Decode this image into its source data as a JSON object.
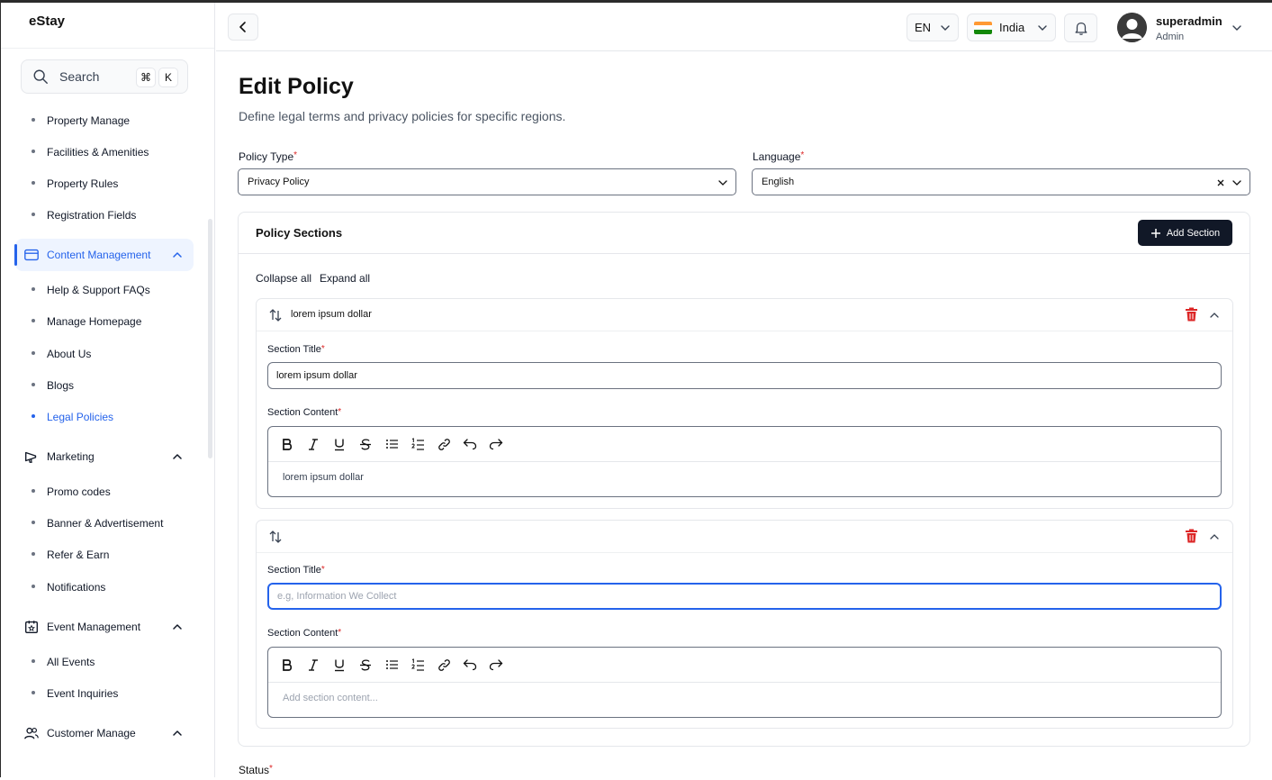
{
  "app": {
    "brand": "eStay"
  },
  "search": {
    "label": "Search",
    "kbd_cmd": "⌘",
    "kbd_key": "K"
  },
  "sidebar": {
    "property_items": [
      "Property Manage",
      "Facilities & Amenities",
      "Property Rules",
      "Registration Fields"
    ],
    "content_group": "Content Management",
    "content_items": [
      "Help & Support FAQs",
      "Manage Homepage",
      "About Us",
      "Blogs",
      "Legal Policies"
    ],
    "marketing_group": "Marketing",
    "marketing_items": [
      "Promo codes",
      "Banner & Advertisement",
      "Refer & Earn",
      "Notifications"
    ],
    "event_group": "Event Management",
    "event_items": [
      "All Events",
      "Event Inquiries"
    ],
    "customer_group": "Customer Manage"
  },
  "header": {
    "language": "EN",
    "country": "India",
    "user_name": "superadmin",
    "user_role": "Admin"
  },
  "page": {
    "title": "Edit Policy",
    "subtitle": "Define legal terms and privacy policies for specific regions.",
    "policy_type_label": "Policy Type",
    "policy_type_value": "Privacy Policy",
    "language_label": "Language",
    "language_value": "English",
    "required_mark": "*",
    "status_label": "Status"
  },
  "sections_card": {
    "title": "Policy Sections",
    "add_button": "Add Section",
    "collapse_all": "Collapse all",
    "expand_all": "Expand all",
    "section_title_label": "Section Title",
    "section_content_label": "Section Content",
    "sections": [
      {
        "header": "lorem ipsum dollar",
        "title_value": "lorem ipsum dollar",
        "content": "lorem ipsum dollar"
      },
      {
        "header": "",
        "title_placeholder": "e.g, Information We Collect",
        "content_placeholder": "Add section content..."
      }
    ]
  },
  "colors": {
    "accent": "#2563eb",
    "danger": "#dc2626",
    "dark_button": "#111827"
  }
}
